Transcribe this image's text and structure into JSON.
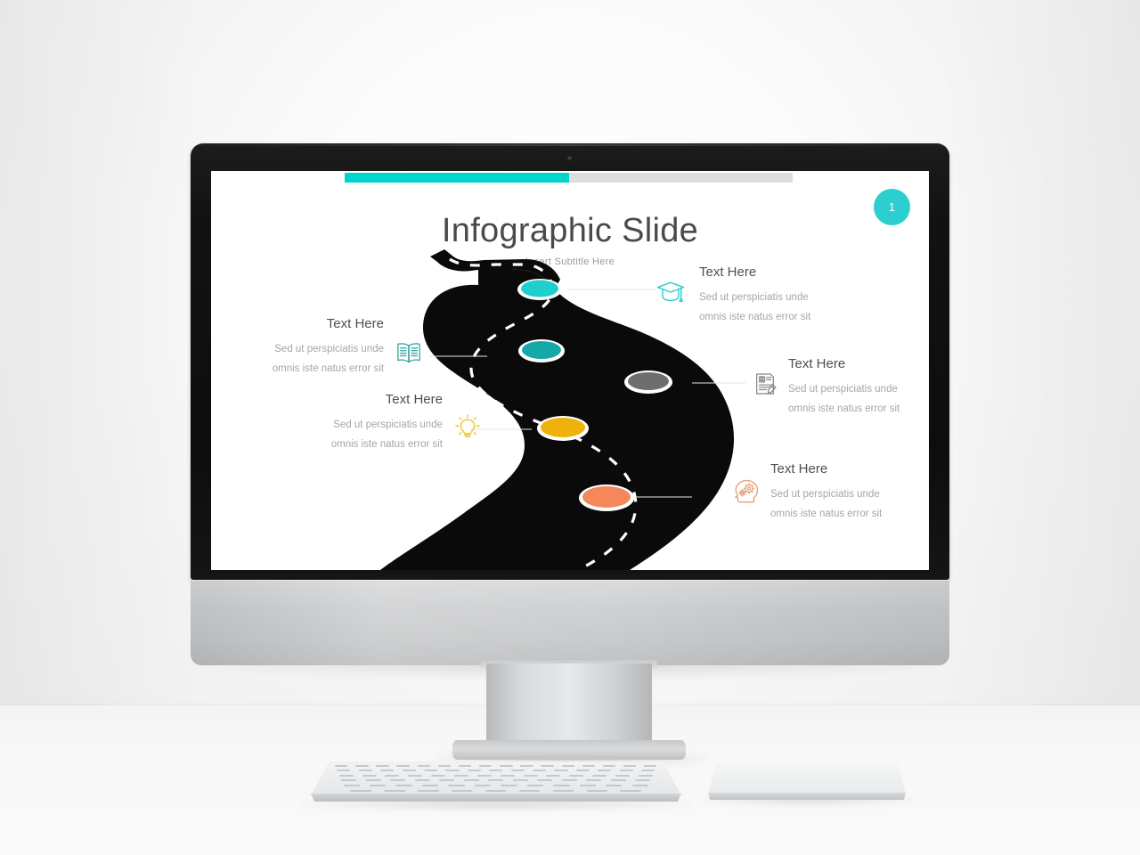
{
  "slide": {
    "title": "Infographic Slide",
    "subtitle": "Insert Subtitle Here",
    "badge": "1",
    "progress": {
      "percent": 50,
      "fill_color": "#00d5cd",
      "track_color": "#dddddd"
    },
    "colors": {
      "accent_teal": "#2ccfcf",
      "road_black": "#0a0a0a",
      "title_gray": "#4a4a4a",
      "body_gray": "#a6a6a6",
      "marker_teal_light": "#1ecfcf",
      "marker_teal_dark": "#16a8a8",
      "marker_gray": "#6e6e6e",
      "marker_yellow": "#eeb20a",
      "marker_orange": "#f4885a"
    }
  },
  "items": [
    {
      "id": "education",
      "icon": "graduation-cap-icon",
      "icon_color": "#2ccfcf",
      "marker_color": "#1ecfcf",
      "side": "right",
      "heading": "Text Here",
      "line1": "Sed ut perspiciatis  unde",
      "line2": "omnis iste natus error  sit"
    },
    {
      "id": "reading",
      "icon": "open-book-icon",
      "icon_color": "#3fa9a2",
      "marker_color": "#16a8a8",
      "side": "left",
      "heading": "Text Here",
      "line1": "Sed ut perspiciatis  unde",
      "line2": "omnis iste natus error  sit"
    },
    {
      "id": "document",
      "icon": "document-pen-icon",
      "icon_color": "#8c8c8c",
      "marker_color": "#6e6e6e",
      "side": "right",
      "heading": "Text Here",
      "line1": "Sed ut perspiciatis  unde",
      "line2": "omnis iste natus error  sit"
    },
    {
      "id": "idea",
      "icon": "lightbulb-icon",
      "icon_color": "#f0c025",
      "marker_color": "#eeb20a",
      "side": "left",
      "heading": "Text Here",
      "line1": "Sed ut perspiciatis  unde",
      "line2": "omnis iste natus error  sit"
    },
    {
      "id": "thinking",
      "icon": "head-gears-icon",
      "icon_color": "#e8a07c",
      "marker_color": "#f4885a",
      "side": "right",
      "heading": "Text Here",
      "line1": "Sed ut perspiciatis  unde",
      "line2": "omnis iste natus error  sit"
    }
  ]
}
